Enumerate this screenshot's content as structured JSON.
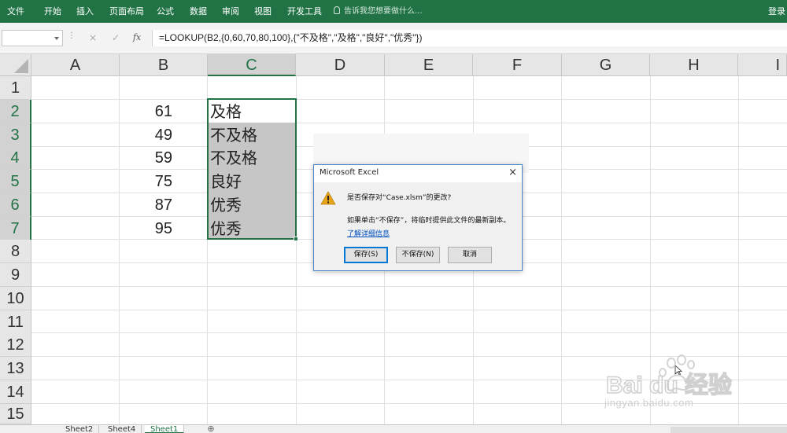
{
  "ribbon": {
    "tabs": [
      "文件",
      "开始",
      "插入",
      "页面布局",
      "公式",
      "数据",
      "审阅",
      "视图",
      "开发工具"
    ],
    "tell_me": "告诉我您想要做什么...",
    "login": "登录",
    "color": "#217346"
  },
  "formula_bar": {
    "cancel_icon": "×",
    "enter_icon": "✓",
    "fx_label": "fx",
    "formula": "=LOOKUP(B2,{0,60,70,80,100},{\"不及格\",\"及格\",\"良好\",\"优秀\"})"
  },
  "grid": {
    "columns": [
      "A",
      "B",
      "C",
      "D",
      "E",
      "F",
      "G",
      "H",
      "I"
    ],
    "rows": [
      "1",
      "2",
      "3",
      "4",
      "5",
      "6",
      "7",
      "8",
      "9",
      "10",
      "11",
      "12",
      "13",
      "14",
      "15"
    ],
    "cells_B": [
      "61",
      "49",
      "59",
      "75",
      "87",
      "95"
    ],
    "cells_C": [
      "及格",
      "不及格",
      "不及格",
      "良好",
      "优秀",
      "优秀"
    ]
  },
  "sheets": {
    "tabs": [
      "Sheet2",
      "Sheet4",
      "Sheet1"
    ],
    "active": "Sheet1",
    "add_symbol": "⊕"
  },
  "dialog": {
    "title": "Microsoft Excel",
    "close": "×",
    "question": "是否保存对“Case.xlsm”的更改?",
    "info": "如果单击“不保存”，将临时提供此文件的最新副本。",
    "help_link": "了解详细信息",
    "buttons": {
      "save": "保存(S)",
      "dont_save": "不保存(N)",
      "cancel": "取消"
    }
  },
  "watermark": {
    "brand": "Bai du 经验",
    "url": "jingyan.baidu.com"
  }
}
